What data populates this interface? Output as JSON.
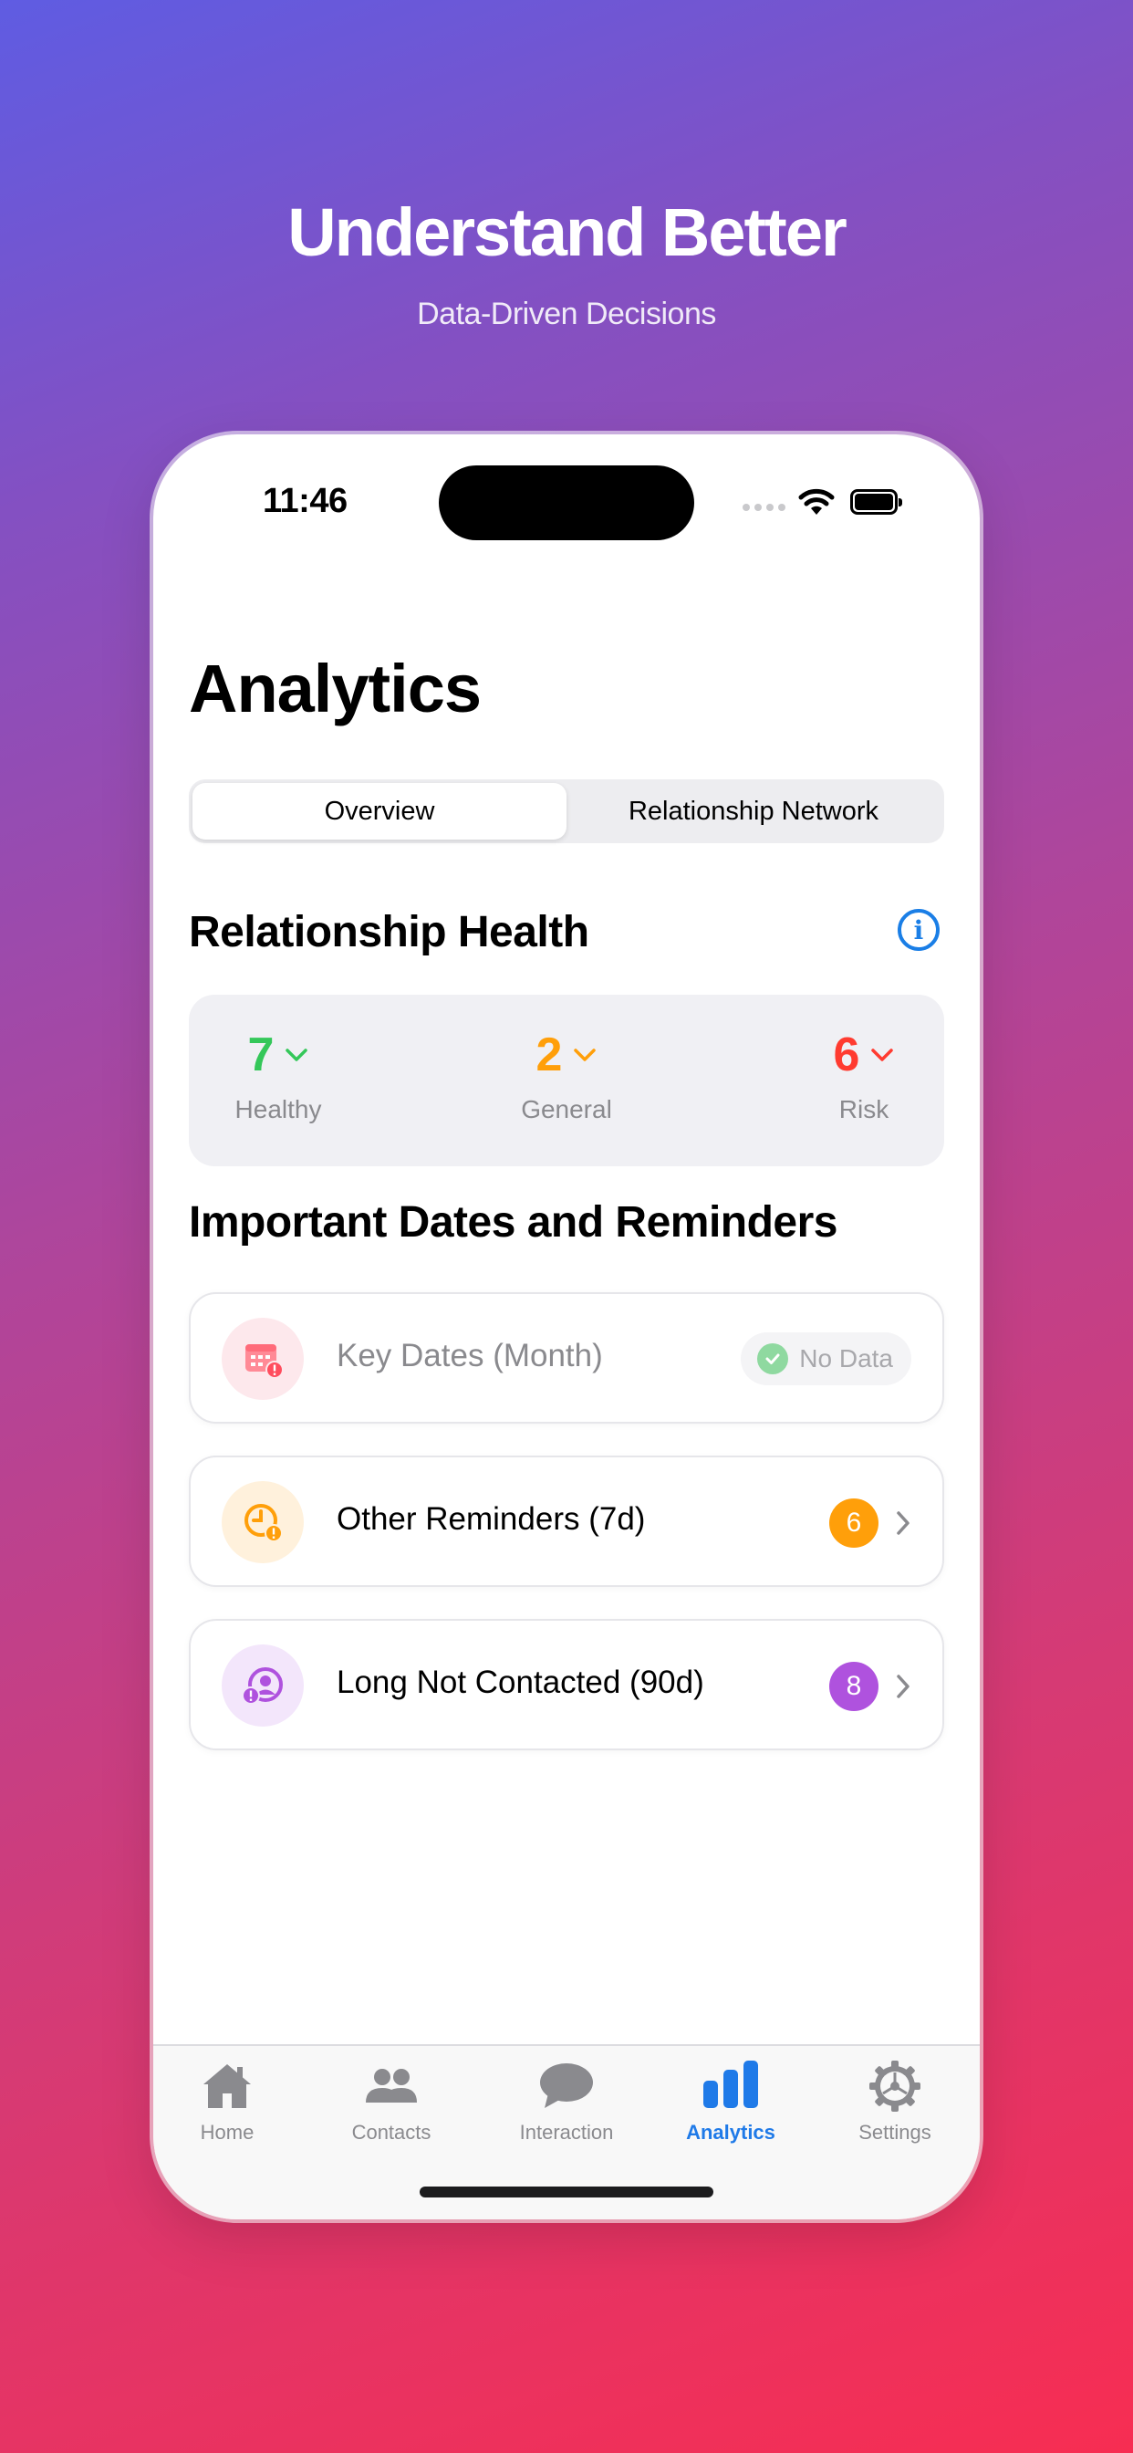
{
  "hero": {
    "title": "Understand Better",
    "subtitle": "Data-Driven Decisions"
  },
  "status_bar": {
    "time": "11:46"
  },
  "page": {
    "title": "Analytics"
  },
  "segments": {
    "items": [
      "Overview",
      "Relationship Network"
    ],
    "selected": "Overview"
  },
  "health": {
    "title": "Relationship Health",
    "metrics": [
      {
        "value": "7",
        "label": "Healthy",
        "color": "#34c759"
      },
      {
        "value": "2",
        "label": "General",
        "color": "#ff9f0a"
      },
      {
        "value": "6",
        "label": "Risk",
        "color": "#ff3b30"
      }
    ]
  },
  "reminders": {
    "title": "Important Dates and Reminders",
    "items": [
      {
        "label": "Key Dates (Month)",
        "status": "No Data",
        "icon": "calendar-alert-icon",
        "color": "#ff6b7a"
      },
      {
        "label": "Other Reminders (7d)",
        "count": "6",
        "icon": "clock-alert-icon",
        "color": "#ff9f0a"
      },
      {
        "label": "Long Not Contacted (90d)",
        "count": "8",
        "icon": "person-alert-icon",
        "color": "#af52de"
      }
    ]
  },
  "tabbar": {
    "items": [
      {
        "label": "Home",
        "icon": "house-icon"
      },
      {
        "label": "Contacts",
        "icon": "people-icon"
      },
      {
        "label": "Interaction",
        "icon": "chat-bubble-icon"
      },
      {
        "label": "Analytics",
        "icon": "bar-chart-icon"
      },
      {
        "label": "Settings",
        "icon": "gear-icon"
      }
    ],
    "active": "Analytics",
    "active_color": "#1f7ae8",
    "inactive_color": "#8a8a8e"
  }
}
